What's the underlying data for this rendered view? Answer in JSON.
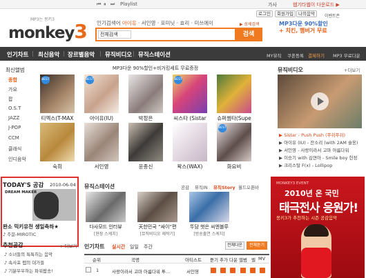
{
  "player_bar": {
    "playlist_label": "Playlist",
    "right1": "가사",
    "right2": "웹기타웹이 다운로드 ▶"
  },
  "util": {
    "login": "로그인",
    "signup": "회원가입",
    "mymusic": "나의음악"
  },
  "logo": {
    "small": "MP3는 몽키3",
    "word": "monkey",
    "three": "3"
  },
  "top_links": [
    "인기검색어",
    "아이유",
    "서인영",
    "포미닛",
    "효리",
    "미쓰에이",
    "..."
  ],
  "top_right_links": [
    "이벤트존",
    "공지",
    "통합연결음",
    "음원몰"
  ],
  "search": {
    "select_value": "전체검색",
    "placeholder": "",
    "button_label": "검색",
    "detail_link": "▶ 상세검색"
  },
  "top_ad": {
    "line1": "MP3다운 90%할인",
    "line2": "+ 치킨, 햄버거 무료"
  },
  "nav": {
    "items": [
      "인기차트",
      "최신음악",
      "장르별음악",
      "뮤직비디오",
      "뮤직스테이션"
    ],
    "right": [
      "MY뮤직",
      "쿠폰등록",
      "결제하기",
      "MP3 무료다운"
    ]
  },
  "left_sidebar": {
    "title": "최신앨범",
    "items": [
      "종합",
      "가요",
      "팝",
      "O.S.T",
      "JAZZ",
      "J-POP",
      "CCM",
      "클래식",
      "인디음악"
    ]
  },
  "promo": {
    "text": "MP3다운 90%할인+비거킹세트 무료증정"
  },
  "albums_row1": [
    "티엑스(T-MAX",
    "아이유(IU)",
    "박정은",
    "씨스타 (Sistar",
    "슈퍼썸타(Supe"
  ],
  "albums_row2": [
    "숙희",
    "서인영",
    "윤종신",
    "왁스(WAX)",
    "화요비"
  ],
  "album_badge": "BEST",
  "music_video": {
    "title": "뮤직비디오",
    "more": "+더보기",
    "lines": [
      "▶ Sistar - Push Push (푸쉬푸쉬)",
      "▶ 아이유 (IU) - 잔소리 (with 2AM 슬옹)",
      "▶ 서인영 - 사랑이라서 고마 아름다워",
      "▶ 이승기 with 김연아 - Smile boy 헌정",
      "▶ 크리스탈 F(x) - Lollipop"
    ]
  },
  "today": {
    "title": "TODAY'S 공감",
    "date": "2010-06-04",
    "img_text": "DREAM MAKER",
    "caption": "완소 믹키유천 생일축하★",
    "sub": "♪ 주문-MIROTIC"
  },
  "recommend": {
    "title": "추천공감",
    "more": "+ 더보기",
    "lines": [
      "♪ 소녀들의 특특히는 음악",
      "♪ 속사포 랩의 대가들",
      "♪ 기분우우하는 파워팝송!"
    ]
  },
  "music_station": {
    "title": "뮤직스테이션",
    "tabs": [
      "공감",
      "뮤직IN",
      "뮤직Story",
      "월드오픈바"
    ],
    "active_tab": "뮤직Story",
    "items": [
      {
        "caption": "다사모드 인터뷰",
        "sub": "[현장 스케치]"
      },
      {
        "caption": "天한민국 “싸이”편",
        "sub": "[뮤직비디오 제작기]"
      },
      {
        "caption": "뚜담 벗은 씨엔블루",
        "sub": "[방송출연 스케치]"
      }
    ]
  },
  "chart": {
    "title": "인기차트",
    "tabs": [
      "실시간",
      "일일",
      "주간"
    ],
    "active_tab": "실시간",
    "btn_allplay": "전체다운",
    "btn_all": "전체듣기",
    "headers": [
      "순위",
      "곡명",
      "아티스트",
      "듣기",
      "추가",
      "다운",
      "앨범",
      "벨",
      "MV"
    ],
    "row": {
      "rank": "1",
      "title": "사랑이라서 고마 아름다워 투…",
      "artist": "서인영"
    }
  },
  "event": {
    "small": "MONKEY3 EVENT",
    "line1": "2010년 온 국민",
    "line2": "태극전사 응원가!",
    "line3": "몽키3가 추천하는 시즌 공감음악"
  }
}
